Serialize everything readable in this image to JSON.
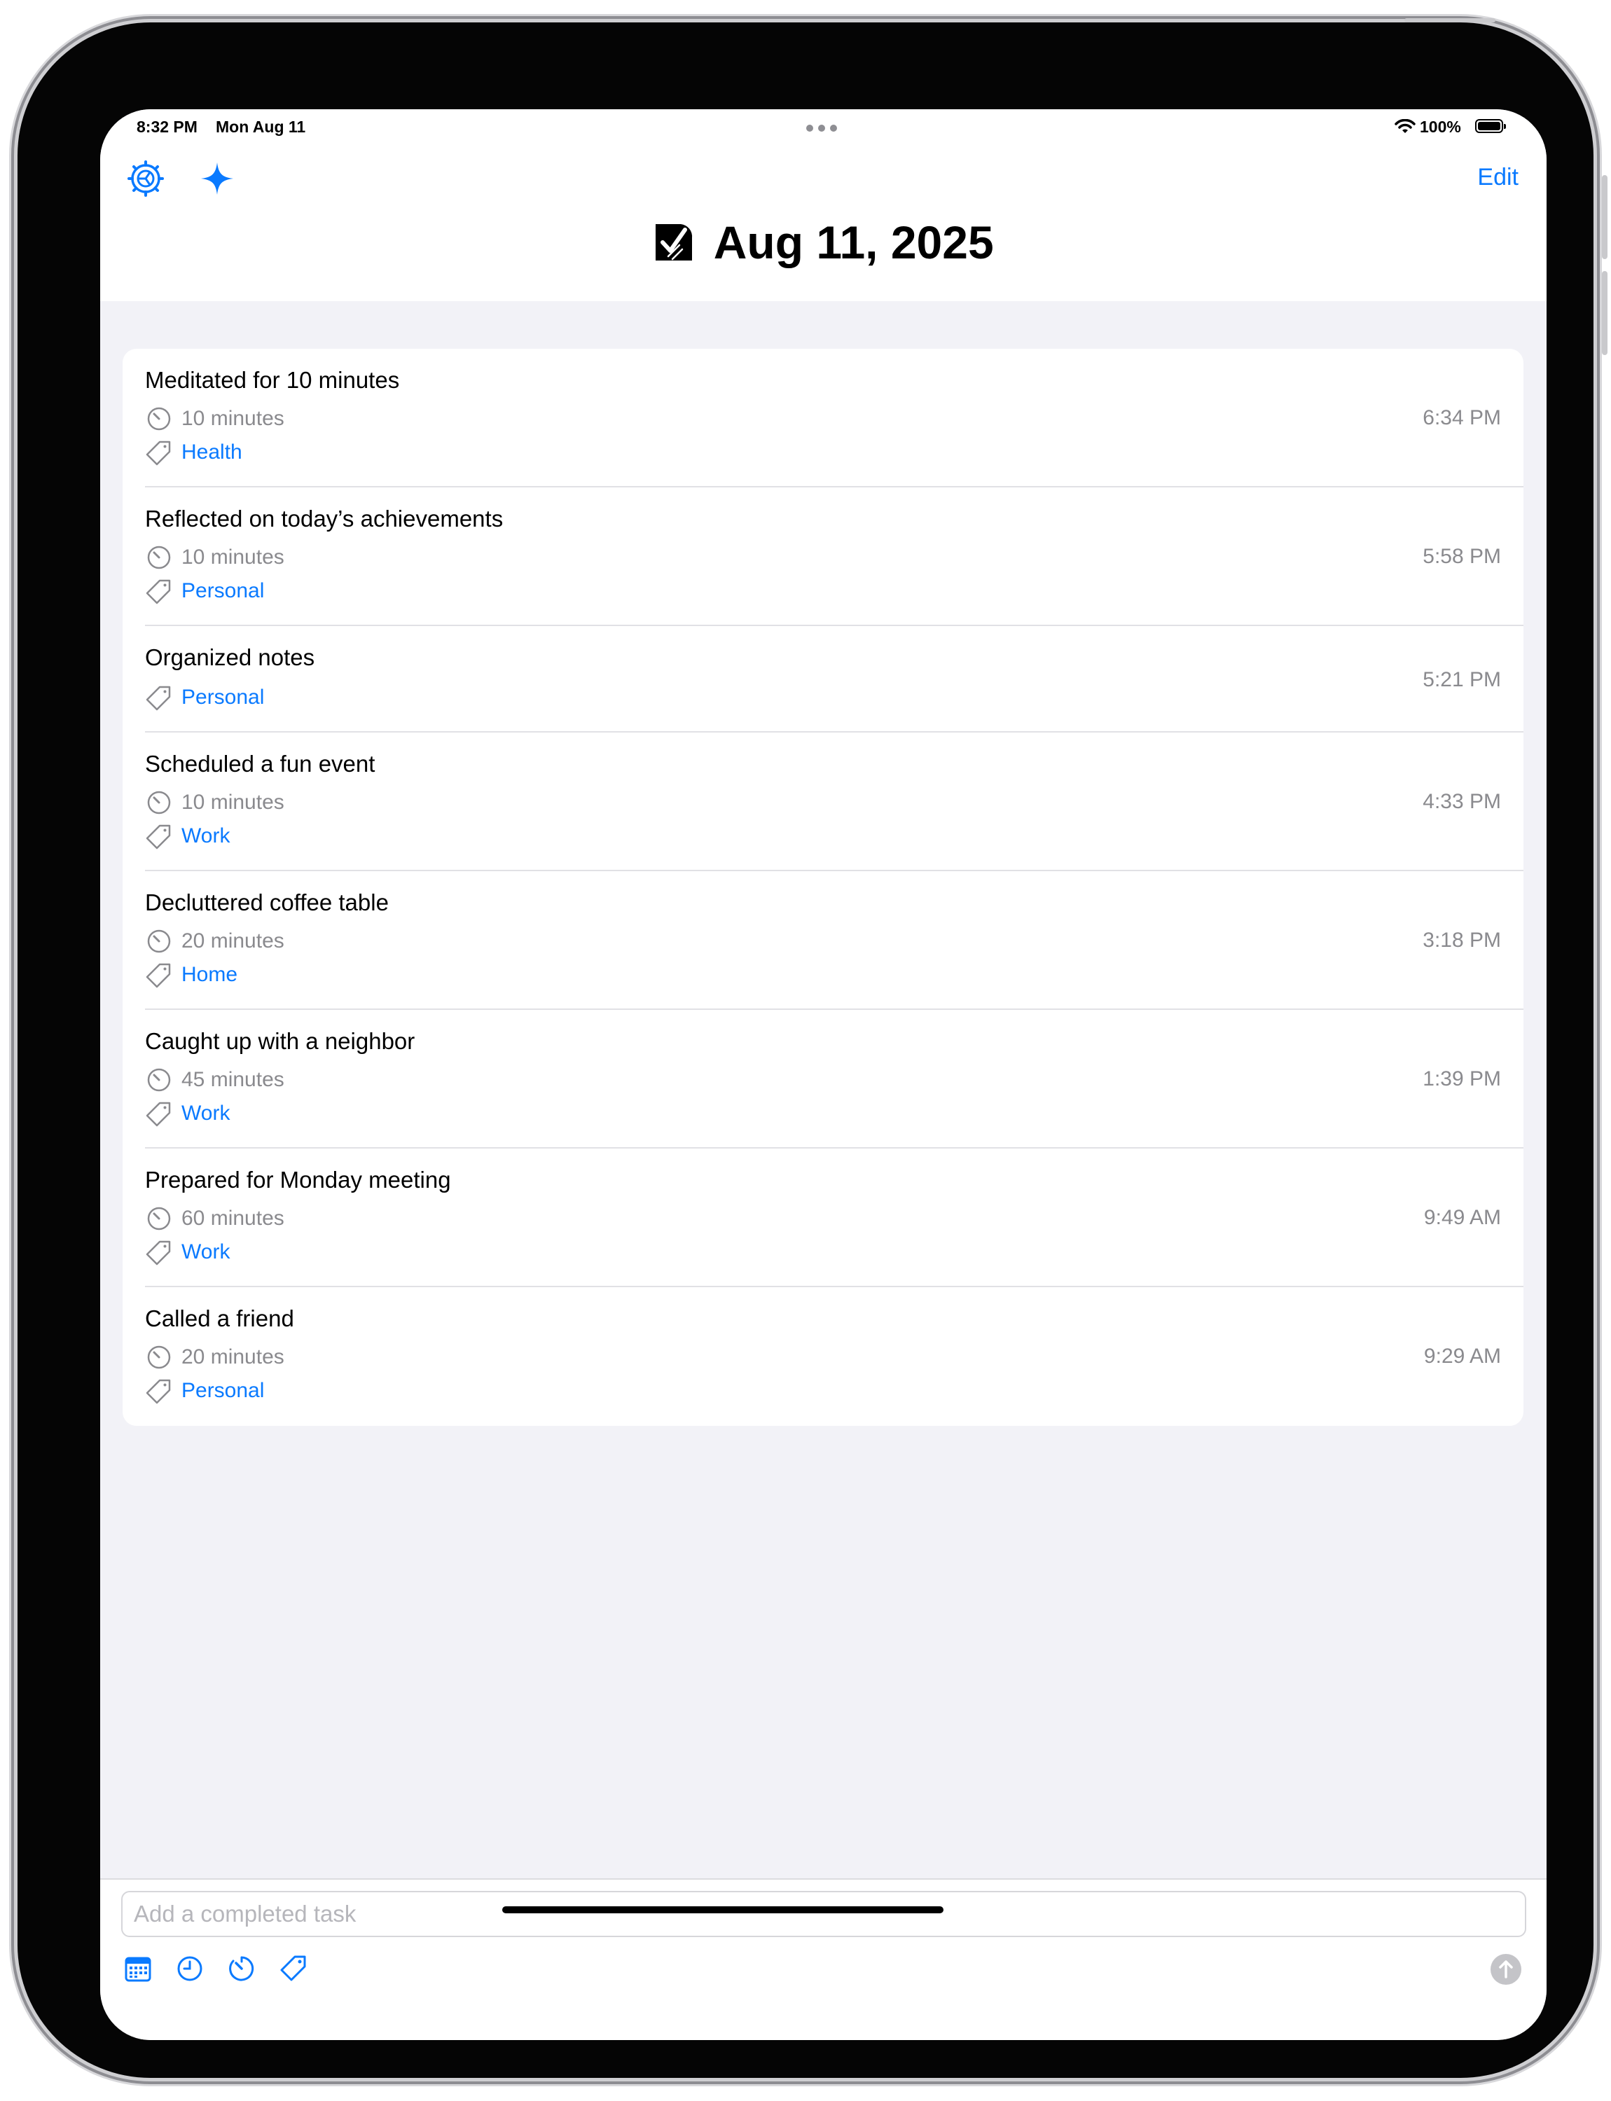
{
  "status_bar": {
    "time": "8:32 PM",
    "date": "Mon Aug 11",
    "battery": "100%"
  },
  "header": {
    "title": "Aug 11, 2025",
    "edit_label": "Edit",
    "left_icons": [
      "settings-gear-icon",
      "sparkle-icon"
    ],
    "accent_color": "#0a7aff"
  },
  "tasks": [
    {
      "title": "Meditated for 10 minutes",
      "duration": "10 minutes",
      "tag": "Health",
      "time": "6:34 PM"
    },
    {
      "title": "Reflected on today’s achievements",
      "duration": "10 minutes",
      "tag": "Personal",
      "time": "5:58 PM"
    },
    {
      "title": "Organized notes",
      "duration": "",
      "tag": "Personal",
      "time": "5:21 PM"
    },
    {
      "title": "Scheduled a fun event",
      "duration": "10 minutes",
      "tag": "Work",
      "time": "4:33 PM"
    },
    {
      "title": "Decluttered coffee table",
      "duration": "20 minutes",
      "tag": "Home",
      "time": "3:18 PM"
    },
    {
      "title": "Caught up with a neighbor",
      "duration": "45 minutes",
      "tag": "Work",
      "time": "1:39 PM"
    },
    {
      "title": "Prepared for Monday meeting",
      "duration": "60 minutes",
      "tag": "Work",
      "time": "9:49 AM"
    },
    {
      "title": "Called a friend",
      "duration": "20 minutes",
      "tag": "Personal",
      "time": "9:29 AM"
    }
  ],
  "composer": {
    "placeholder": "Add a completed task",
    "tools": [
      "calendar-icon",
      "clock-icon",
      "timer-icon",
      "tag-icon"
    ],
    "send_icon": "send-arrow-icon"
  }
}
